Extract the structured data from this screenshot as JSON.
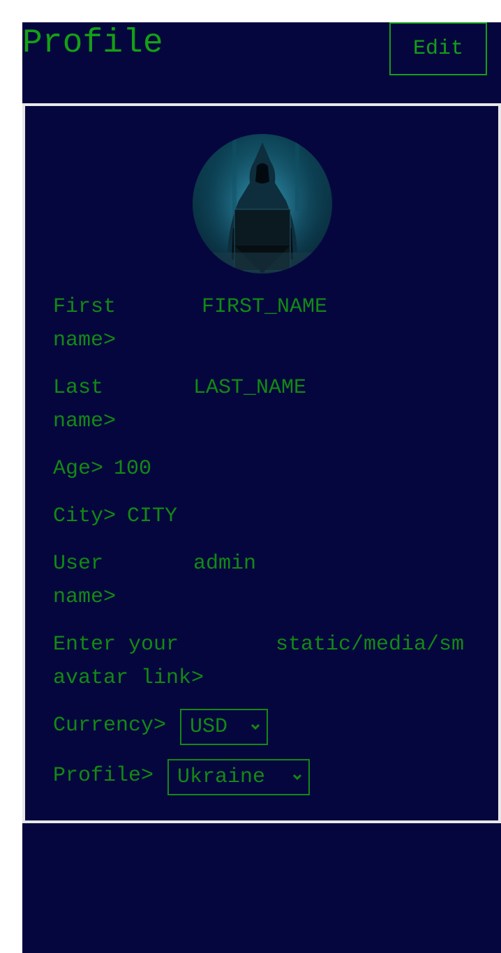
{
  "header": {
    "title": "Profile",
    "edit_label": "Edit"
  },
  "profile": {
    "avatar_icon": "hooded-hacker-avatar",
    "fields": {
      "first_name": {
        "label": "First\nname>",
        "value": "FIRST_NAME"
      },
      "last_name": {
        "label": "Last\nname>",
        "value": "LAST_NAME"
      },
      "age": {
        "label": "Age>",
        "value": "100"
      },
      "city": {
        "label": "City>",
        "value": "CITY"
      },
      "user_name": {
        "label": "User\nname>",
        "value": "admin"
      },
      "avatar_link": {
        "label": "Enter your\navatar link>",
        "value": "static/media/sm"
      },
      "currency": {
        "label": "Currency>",
        "selected": "USD"
      },
      "profile_country": {
        "label": "Profile>",
        "selected": "Ukraine"
      }
    }
  },
  "colors": {
    "background": "#06063f",
    "accent_green": "#14a014",
    "divider": "#e8e8e8"
  }
}
